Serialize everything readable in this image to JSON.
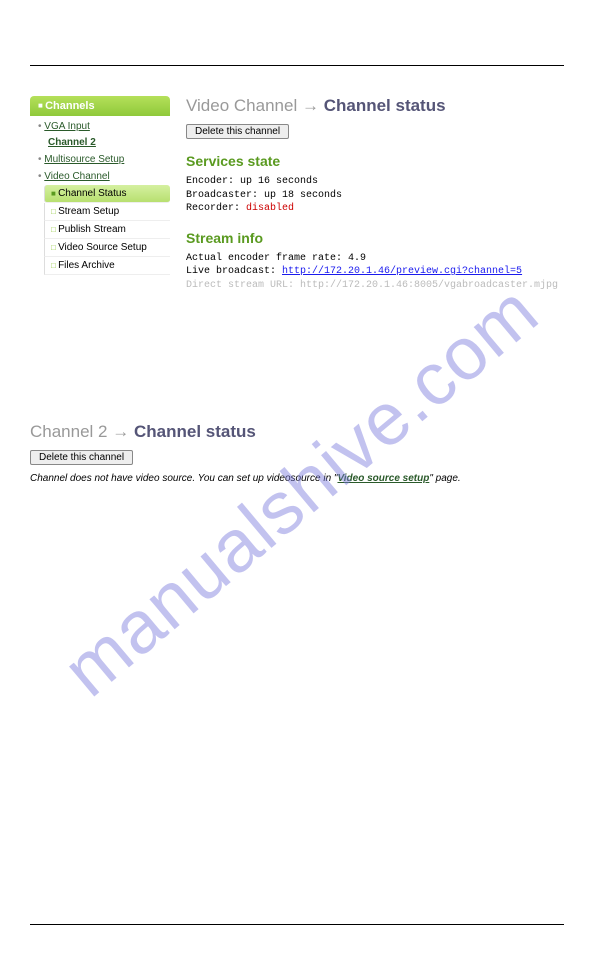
{
  "watermark": "manualshive.com",
  "sidebar": {
    "header": "Channels",
    "items": [
      {
        "label": "VGA Input"
      },
      {
        "label": "Channel 2",
        "bold": true
      },
      {
        "label": "Multisource Setup"
      },
      {
        "label": "Video Channel"
      }
    ],
    "sub": [
      {
        "label": "Channel Status"
      },
      {
        "label": "Stream Setup"
      },
      {
        "label": "Publish Stream"
      },
      {
        "label": "Video Source Setup"
      },
      {
        "label": "Files Archive"
      }
    ]
  },
  "section1": {
    "title_pre": "Video Channel",
    "title_post": "Channel status",
    "delete_btn": "Delete this channel",
    "services_heading": "Services state",
    "encoder_line": "Encoder: up 16 seconds",
    "broadcaster_line": "Broadcaster: up 18 seconds",
    "recorder_label": "Recorder: ",
    "recorder_value": "disabled",
    "stream_heading": "Stream info",
    "framerate_line": "Actual encoder frame rate: 4.9",
    "live_label": "Live broadcast: ",
    "live_url": "http://172.20.1.46/preview.cgi?channel=5",
    "direct_line": "Direct stream URL: http://172.20.1.46:8005/vgabroadcaster.mjpg"
  },
  "section2": {
    "title_pre": "Channel 2",
    "title_post": "Channel status",
    "delete_btn": "Delete this channel",
    "help_pre": "Channel does not have video source. You can set up videosource in \"",
    "help_link": "Video source setup",
    "help_post": "\" page."
  }
}
